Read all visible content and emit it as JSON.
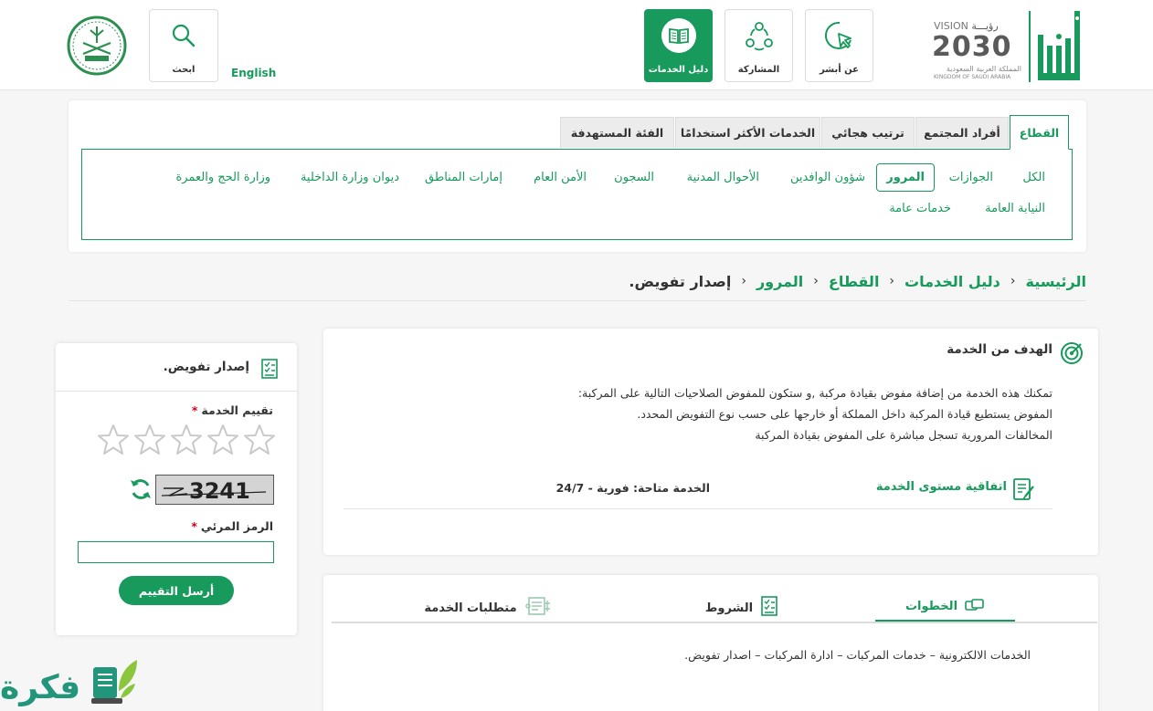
{
  "header": {
    "logo_absher": "أبشر",
    "vision": {
      "word": "VISION",
      "arabic_word": "رؤيـــة",
      "year": "2030",
      "kingdom_ar": "المملكة العربية السعودية",
      "kingdom_en": "KINGDOM OF SAUDI ARABIA"
    },
    "nav": [
      {
        "label": "عن أبشر",
        "icon": "pointer-icon"
      },
      {
        "label": "المشاركة",
        "icon": "people-icon"
      },
      {
        "label": "دليل الخدمات",
        "icon": "book-icon",
        "active": true
      }
    ],
    "search_label": "ابحث",
    "language_label": "English"
  },
  "tabs": [
    {
      "label": "القطاع",
      "active": true
    },
    {
      "label": "أفراد المجتمع"
    },
    {
      "label": "ترتيب هجائي"
    },
    {
      "label": "الخدمات الأكثر استخدامًا"
    },
    {
      "label": "الفئة المستهدفة"
    }
  ],
  "sectors": [
    "الكل",
    "الجوازات",
    "المرور",
    "شؤون الوافدين",
    "الأحوال المدنية",
    "السجون",
    "الأمن العام",
    "إمارات المناطق",
    "ديوان وزارة الداخلية",
    "وزارة الحج والعمرة",
    "النيابة العامة",
    "خدمات عامة"
  ],
  "breadcrumb": {
    "items": [
      "الرئيسية",
      "دليل الخدمات",
      "القطاع",
      "المرور"
    ],
    "current": "إصدار تفويض."
  },
  "goal": {
    "title": "الهدف من الخدمة",
    "lines": [
      "تمكنك هذه الخدمة من إضافة مفوض بقيادة مركبة ,و ستكون للمفوض الصلاحيات التالية على المركبة:",
      "المفوض يستطيع قيادة المركبة داخل المملكة أو خارجها على حسب نوع التفويض المحدد.",
      "المخالفات المرورية تسجل مباشرة على المفوض بقيادة المركبة"
    ],
    "sla_label": "اتفاقية مستوى الخدمة",
    "availability": "الخدمة متاحة: فورية - 24/7"
  },
  "info_tabs": {
    "tabs": [
      {
        "label": "الخطوات",
        "icon": "steps-icon",
        "active": true
      },
      {
        "label": "الشروط",
        "icon": "conditions-icon"
      },
      {
        "label": "متطلبات الخدمة",
        "icon": "requirements-icon"
      }
    ],
    "steps_text": "الخدمات الالكترونية – خدمات المركبات – ادارة المركبات – اصدار تفويض."
  },
  "rating": {
    "title": "إصدار تفويض.",
    "rating_label": "تقييم الخدمة",
    "required_mark": "*",
    "stars_total": 5,
    "stars_selected": 0,
    "captcha_text": "3241",
    "captcha_label": "الرمز المرئي",
    "captcha_value": "",
    "submit_label": "أرسل التقييم"
  },
  "watermark": {
    "text": "فكرة"
  },
  "colors": {
    "primary": "#179a5b",
    "required": "#d0021b",
    "watermark": "#21967a"
  }
}
